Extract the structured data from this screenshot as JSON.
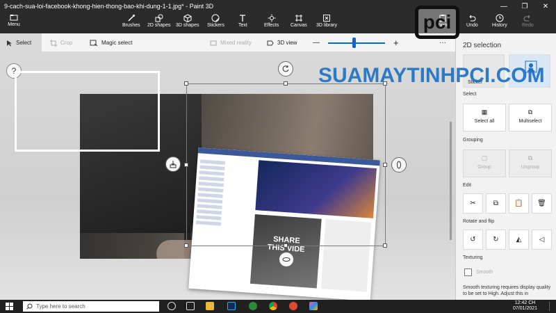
{
  "window": {
    "title": "9-cach-sua-loi-facebook-khong-hien-thong-bao-khi-dung-1-1.jpg* - Paint 3D",
    "minimize": "—",
    "maximize": "❐",
    "close": "✕"
  },
  "ribbon": {
    "menu_label": "Menu",
    "tools": [
      "Brushes",
      "2D shapes",
      "3D shapes",
      "Stickers",
      "Text",
      "Effects",
      "Canvas",
      "3D library",
      "Paste",
      "Undo",
      "History",
      "Redo"
    ]
  },
  "toolbar": {
    "select": "Select",
    "crop": "Crop",
    "magic_select": "Magic select",
    "mixed_reality": "Mixed reality",
    "view_3d": "3D view",
    "zoom_out": "—",
    "zoom_in": "+",
    "more": "···",
    "zoom_level": 0.45
  },
  "canvas": {
    "help": "?",
    "share_line1": "SHARE",
    "share_line2": "THIS VIDE"
  },
  "panel": {
    "title": "2D selection",
    "top_tile_left": "Sticker",
    "select_heading": "Select",
    "select_all": "Select all",
    "multiselect": "Multiselect",
    "grouping_heading": "Grouping",
    "group": "Group",
    "ungroup": "Ungroup",
    "edit_heading": "Edit",
    "rotate_heading": "Rotate and flip",
    "texturing_heading": "Texturing",
    "smooth": "Smooth",
    "description": "Smooth texturing requires display quality to be set to High. Adjust this in"
  },
  "watermark": {
    "logo": "pci",
    "site": "SUAMAYTINHPCI.COM"
  },
  "taskbar": {
    "search_placeholder": "Type here to search",
    "time": "12:42 CH",
    "date": "07/01/2021"
  },
  "colors": {
    "accent": "#0a66c8",
    "titlebar": "#2b2b2b",
    "taskbar": "#202020",
    "watermark_blue": "#1a6fc2"
  }
}
